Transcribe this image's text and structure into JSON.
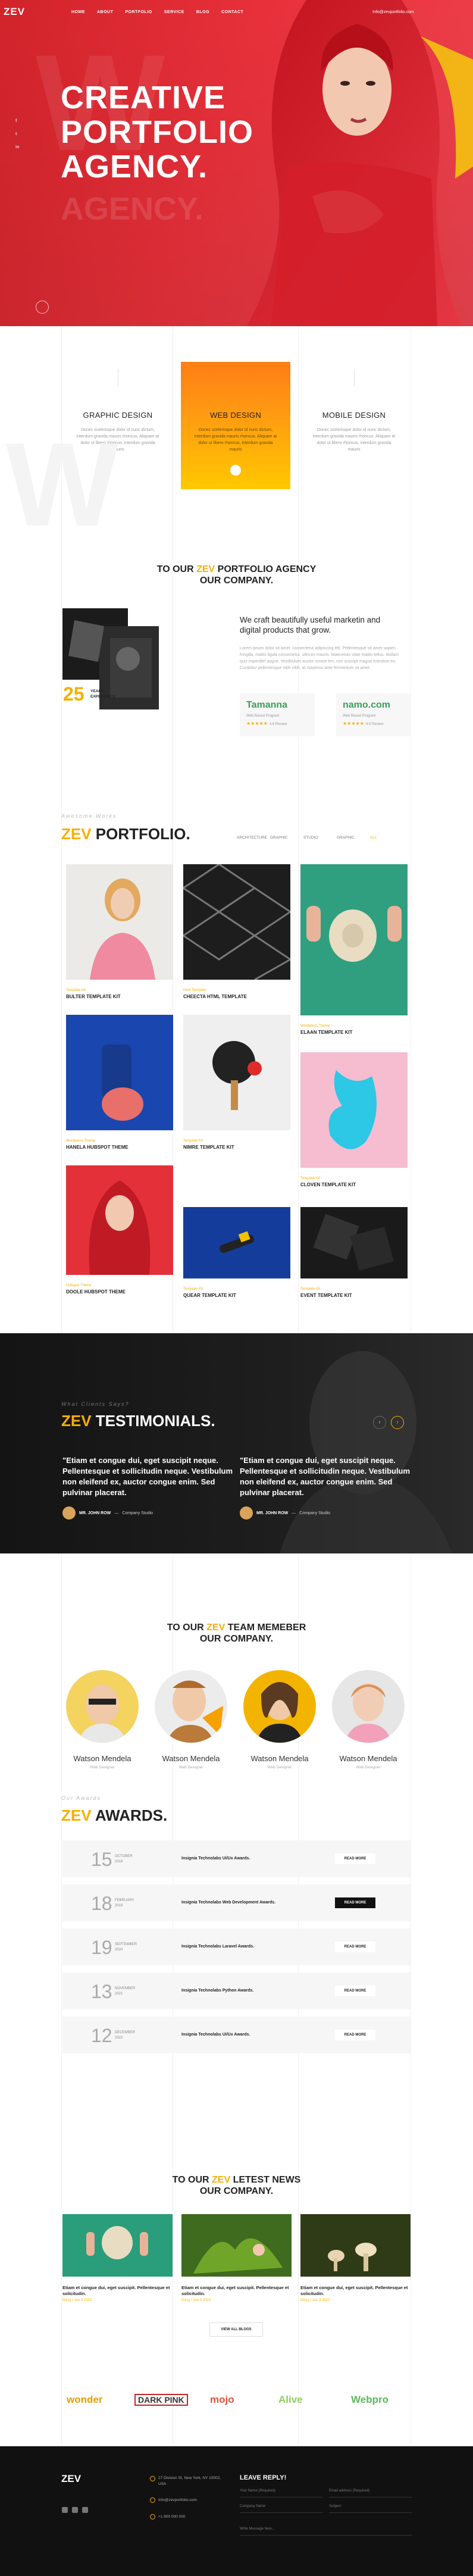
{
  "header": {
    "logo": "ZEV",
    "nav": [
      "HOME",
      "ABOUT",
      "PORTFOLIO",
      "SERVICE",
      "BLOG",
      "CONTACT"
    ],
    "contact": "Info@zevportfolio.com"
  },
  "hero": {
    "title_line1": "CREATIVE",
    "title_line2": "PORTFOLIO",
    "title_line3": "AGENCY.",
    "echo": "AGENCY."
  },
  "services": [
    {
      "title": "GRAPHIC DESIGN",
      "text": "Donec scelerisque dolor id nunc dictum, interdum gravida mauris rhoncus. Aliquam at dolor ut libero rhoncus, interdum gravida mauris"
    },
    {
      "title": "WEB DESIGN",
      "text": "Donec scelerisque dolor id nunc dictum, interdum gravida mauris rhoncus. Aliquam at dolor ut libero rhoncus, interdum gravida mauris"
    },
    {
      "title": "MOBILE DESIGN",
      "text": "Donec scelerisque dolor id nunc dictum, interdum gravida mauris rhoncus. Aliquam at dolor ut libero rhoncus, interdum gravida mauris"
    }
  ],
  "about": {
    "head_pre": "TO OUR ",
    "head_accent": "ZEV",
    "head_post": " PORTFOLIO AGENCY",
    "head_line2": "OUR COMPANY.",
    "years": "25",
    "years_label": "YEARS EXPERIENCE",
    "lead": "We craft beautifully useful marketin and digital products that grow.",
    "body": "Lorem ipsum dolor sit amet, consectetur adipiscing elit. Pellentesque sit amet sapien fringilla, mattis ligula consectetur, ultrices mauris. Maecenas vitae mattis tellus. Nullam quis imperdiet augue. Vestibulum auctor ornare leo, non suscipit magna interdum eu. Curabitur pellentesque nibh nibh, at maximus ante fermentum sit amet.",
    "partners": [
      {
        "name": "Tamanna",
        "sub": "Web Based Program",
        "rating": "4.9 Review"
      },
      {
        "name": "namo.com",
        "sub": "Web Based Program",
        "rating": "4.9 Review"
      }
    ]
  },
  "portfolio": {
    "subtitle": "Awesome Works",
    "title_accent": "ZEV",
    "title_rest": " PORTFOLIO.",
    "filters": [
      "ARCHITECTURE",
      "GRAPHIC",
      "STUDIO",
      "GRAPHIC",
      "ALL"
    ],
    "items": [
      {
        "cat": "Template Kit",
        "name": "BULTER TEMPLATE KIT"
      },
      {
        "cat": "Html Template",
        "name": "CHEECTA HTML TEMPLATE"
      },
      {
        "cat": "Wordpress Theme",
        "name": "ELAAN TEMPLATE KIT"
      },
      {
        "cat": "Wordpress Theme",
        "name": "HANELA HUBSPOT THEME"
      },
      {
        "cat": "Template Kit",
        "name": "NIMRE TEMPLATE KIT"
      },
      {
        "cat": "Template Kit",
        "name": "CLOVEN TEMPLATE KIT"
      },
      {
        "cat": "Hubspot Theme",
        "name": "DOOLE HUBSPOT THEME"
      },
      {
        "cat": "Template Kit",
        "name": "QUEAR TEMPLATE KIT"
      },
      {
        "cat": "Template Kit",
        "name": "EVENT TEMPLATE KIT"
      }
    ]
  },
  "testimonials": {
    "subtitle": "What Clients Says?",
    "title_accent": "ZEV",
    "title_rest": " TESTIMONIALS.",
    "items": [
      {
        "quote": "\"Etiam et congue dui, eget suscipit neque. Pellentesque et sollicitudin neque. Vestibulum non eleifend ex, auctor congue enim. Sed pulvinar placerat.",
        "author": "MR. JOHN ROW",
        "role": "Company Studio"
      },
      {
        "quote": "\"Etiam et congue dui, eget suscipit neque. Pellentesque et sollicitudin neque. Vestibulum non eleifend ex, auctor congue enim. Sed pulvinar placerat.",
        "author": "MR. JOHN ROW",
        "role": "Company Studio"
      }
    ],
    "prev": "‹",
    "next": "›"
  },
  "team": {
    "head_pre": "TO OUR ",
    "head_accent": "ZEV",
    "head_post": " TEAM MEMEBER",
    "head_line2": "OUR COMPANY.",
    "members": [
      {
        "name": "Watson Mendela",
        "role": "Web Designer"
      },
      {
        "name": "Watson Mendela",
        "role": "Web Designer"
      },
      {
        "name": "Watson Mendela",
        "role": "Web Designer"
      },
      {
        "name": "Watson Mendela",
        "role": "Web Designer"
      }
    ]
  },
  "awards": {
    "subtitle": "Our Awards",
    "title_accent": "ZEV",
    "title_rest": " AWARDS.",
    "items": [
      {
        "day": "15",
        "month": "OCTOBER 2018",
        "name": "Insignia Technolabs Ui/Ux Awards.",
        "btn": "READ MORE"
      },
      {
        "day": "18",
        "month": "FEBRUARY 2019",
        "name": "Insignia Technolabs Web Development Awards.",
        "btn": "READ MORE"
      },
      {
        "day": "19",
        "month": "SEPTEMBER 2020",
        "name": "Insignia Technolabs Laravel Awards.",
        "btn": "READ MORE"
      },
      {
        "day": "13",
        "month": "NOVEMBER 2021",
        "name": "Insignia Technolabs Python Awards.",
        "btn": "READ MORE"
      },
      {
        "day": "12",
        "month": "DECEMBER 2022",
        "name": "Insignia Technolabs Ui/Ux Awards.",
        "btn": "READ MORE"
      }
    ]
  },
  "news": {
    "head_pre": "TO OUR ",
    "head_accent": "ZEV",
    "head_post": " LETEST NEWS",
    "head_line2": "OUR COMPANY.",
    "items": [
      {
        "title": "Etiam et congue dui, eget suscipit. Pellentesque et solicitudin.",
        "date": "Dizzy / Jun 3 2022"
      },
      {
        "title": "Etiam et congue dui, eget suscipit. Pellentesque et solicitudin.",
        "date": "Dizzy / Jun 3 2022"
      },
      {
        "title": "Etiam et congue dui, eget suscipit. Pellentesque et solicitudin.",
        "date": "Dizzy / Jun 3 2022"
      }
    ],
    "button": "VIEW ALL BLOGS"
  },
  "brands": [
    "wonder",
    "DARK PINK",
    "mojo",
    "Alive",
    "Webpro"
  ],
  "footer": {
    "logo": "ZEV",
    "address": "27 Division St, New York, NY 10002, USA",
    "email": "Info@zevportfolio.com",
    "phone": "+1 800 000 000",
    "reply_title": "LEAVE REPLY!",
    "fields": [
      "Your Name (Required)",
      "Email address (Required)",
      "Company Name",
      "Subject",
      "Write Message here..."
    ]
  },
  "colors": {
    "accent": "#f5b000",
    "hero_red": "#e2252e",
    "dark": "#141414"
  }
}
